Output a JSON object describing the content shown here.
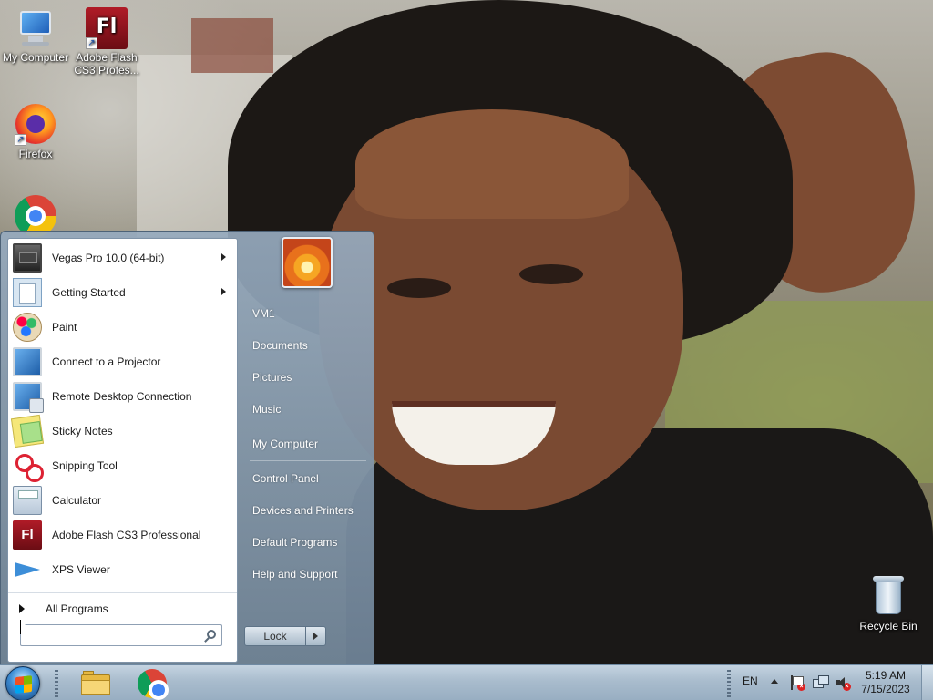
{
  "desktop": {
    "icons": [
      {
        "label": "My Computer",
        "icon": "computer-icon"
      },
      {
        "label": "Adobe Flash CS3 Profes...",
        "icon": "flash-icon",
        "glyph": "Fl"
      },
      {
        "label": "Firefox",
        "icon": "firefox-icon"
      },
      {
        "label": "",
        "icon": "chrome-icon"
      },
      {
        "label": "Recycle Bin",
        "icon": "recycle-bin-icon"
      }
    ]
  },
  "start_menu": {
    "programs": [
      {
        "label": "Vegas Pro 10.0 (64-bit)",
        "icon": "vegas-pro-icon",
        "submenu": true
      },
      {
        "label": "Getting Started",
        "icon": "getting-started-icon",
        "submenu": true
      },
      {
        "label": "Paint",
        "icon": "paint-icon",
        "submenu": false
      },
      {
        "label": "Connect to a Projector",
        "icon": "projector-icon",
        "submenu": false
      },
      {
        "label": "Remote Desktop Connection",
        "icon": "remote-desktop-icon",
        "submenu": false
      },
      {
        "label": "Sticky Notes",
        "icon": "sticky-notes-icon",
        "submenu": false
      },
      {
        "label": "Snipping Tool",
        "icon": "snipping-tool-icon",
        "submenu": false
      },
      {
        "label": "Calculator",
        "icon": "calculator-icon",
        "submenu": false
      },
      {
        "label": "Adobe Flash CS3 Professional",
        "icon": "flash-icon",
        "glyph": "Fl",
        "submenu": false
      },
      {
        "label": "XPS Viewer",
        "icon": "xps-viewer-icon",
        "submenu": false
      }
    ],
    "all_programs_label": "All Programs",
    "search": {
      "value": "",
      "placeholder": ""
    },
    "right_links": [
      {
        "label": "VM1"
      },
      {
        "label": "Documents"
      },
      {
        "label": "Pictures"
      },
      {
        "label": "Music"
      },
      {
        "label": "My Computer"
      },
      {
        "label": "Control Panel"
      },
      {
        "label": "Devices and Printers"
      },
      {
        "label": "Default Programs"
      },
      {
        "label": "Help and Support"
      }
    ],
    "lock_label": "Lock"
  },
  "taskbar": {
    "pinned": [
      {
        "icon": "folder-icon"
      },
      {
        "icon": "chrome-icon"
      }
    ],
    "tray": {
      "language": "EN",
      "time": "5:19 AM",
      "date": "7/15/2023"
    }
  }
}
